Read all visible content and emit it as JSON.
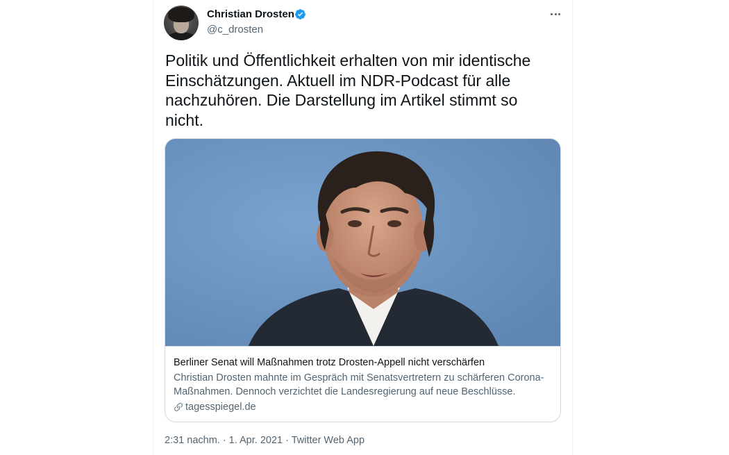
{
  "tweet": {
    "author_name": "Christian Drosten",
    "author_handle": "@c_drosten",
    "text": "Politik und Öffentlichkeit erhalten von mir identische Einschätzungen. Aktuell im NDR-Podcast für alle nachzuhören. Die Darstellung im Artikel stimmt so nicht.",
    "timestamp": "2:31 nachm. · 1. Apr. 2021 · Twitter Web App"
  },
  "card": {
    "title": "Berliner Senat will Maßnahmen trotz Drosten-Appell nicht verschärfen",
    "description": "Christian Drosten mahnte im Gespräch mit Senatsvertretern zu schärferen Corona-Maßnahmen. Dennoch verzichtet die Landesregierung auf neue Beschlüsse.",
    "domain": "tagesspiegel.de"
  },
  "colors": {
    "verified_badge": "#1d9bf0",
    "secondary_text": "#536471",
    "border": "#cfd9de"
  },
  "icons": {
    "verified": "verified-badge-icon",
    "more": "more-options-icon",
    "link": "link-icon"
  }
}
